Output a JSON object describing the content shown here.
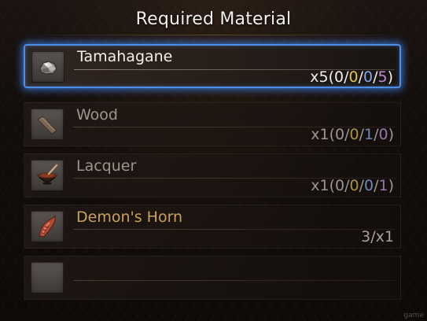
{
  "title": "Required Material",
  "materials": [
    {
      "name": "Tamahagane",
      "icon": "tamahagane-icon",
      "qty_prefix": "x5(",
      "counts": [
        "0",
        "0",
        "0",
        "5"
      ],
      "qty_suffix": ")",
      "selected": true
    },
    {
      "name": "Wood",
      "icon": "wood-icon",
      "qty_prefix": "x1(",
      "counts": [
        "0",
        "0",
        "1",
        "0"
      ],
      "qty_suffix": ")",
      "selected": false
    },
    {
      "name": "Lacquer",
      "icon": "lacquer-bowl-icon",
      "qty_prefix": "x1(",
      "counts": [
        "0",
        "0",
        "0",
        "1"
      ],
      "qty_suffix": ")",
      "selected": false
    },
    {
      "name": "Demon's Horn",
      "icon": "demon-horn-icon",
      "qty": "3/x1",
      "selected": false
    },
    {
      "name": "",
      "icon": "empty-slot",
      "selected": false
    }
  ],
  "colors": {
    "selection_border": "#4d8fe6",
    "rarity_gold": "#c9a35c",
    "count_yellow": "#e0c64c",
    "count_blue": "#7fa6e8",
    "count_purple": "#c08ad8"
  },
  "watermark": "game"
}
